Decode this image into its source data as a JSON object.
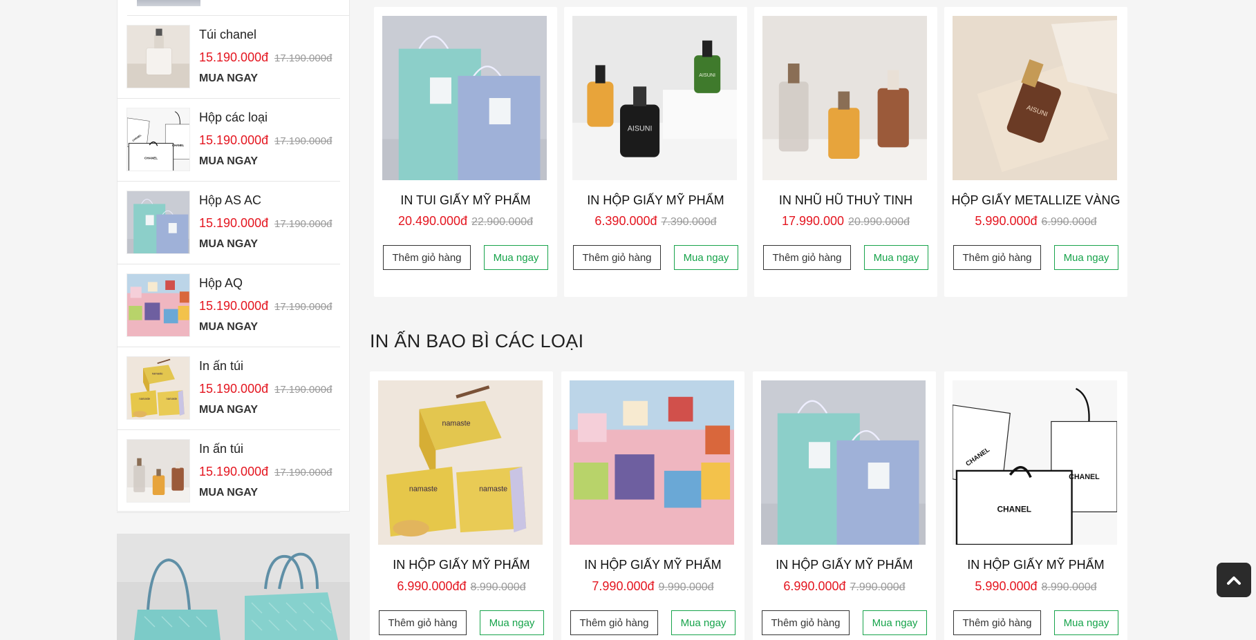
{
  "sidebar": {
    "items": [
      {
        "name": "Túi chanel",
        "price": "15.190.000đ",
        "old_price": "17.190.000đ",
        "buy_label": "MUA NGAY",
        "img": "serum"
      },
      {
        "name": "Hộp các loại",
        "price": "15.190.000đ",
        "old_price": "17.190.000đ",
        "buy_label": "MUA NGAY",
        "img": "chanel"
      },
      {
        "name": "Hộp AS AC",
        "price": "15.190.000đ",
        "old_price": "17.190.000đ",
        "buy_label": "MUA NGAY",
        "img": "bags"
      },
      {
        "name": "Hộp AQ",
        "price": "15.190.000đ",
        "old_price": "17.190.000đ",
        "buy_label": "MUA NGAY",
        "img": "cubes"
      },
      {
        "name": "In ấn túi",
        "price": "15.190.000đ",
        "old_price": "17.190.000đ",
        "buy_label": "MUA NGAY",
        "img": "boxes"
      },
      {
        "name": "In ấn túi",
        "price": "15.190.000đ",
        "old_price": "17.190.000đ",
        "buy_label": "MUA NGAY",
        "img": "bottles"
      }
    ]
  },
  "top_products": [
    {
      "title": "IN TUI GIẤY MỸ PHẨM",
      "price": "20.490.000đ",
      "old_price": "22.900.000đ",
      "img": "bags"
    },
    {
      "title": "IN HỘP GIẤY MỸ PHẨM",
      "price": "6.390.000đ",
      "old_price": "7.390.000đ",
      "img": "aisuni"
    },
    {
      "title": "IN NHŨ HŨ THUỶ TINH",
      "price": "17.990.000",
      "old_price": "20.990.000đ",
      "img": "bottles"
    },
    {
      "title": "HỘP GIẤY METALLIZE VÀNG",
      "price": "5.990.000đ",
      "old_price": "6.990.000đ",
      "img": "serum_stone"
    }
  ],
  "section": {
    "title": "IN ẤN BAO BÌ CÁC LOẠI"
  },
  "section_products": [
    {
      "title": "IN HỘP GIẤY MỸ PHẨM",
      "price": "6.990.000đđ",
      "old_price": "8.990.000đ",
      "img": "boxes"
    },
    {
      "title": "IN HỘP GIẤY MỸ PHẨM",
      "price": "7.990.000đ",
      "old_price": "9.990.000đ",
      "img": "cubes"
    },
    {
      "title": "IN HỘP GIẤY MỸ PHẨM",
      "price": "6.990.000đ",
      "old_price": "7.990.000đ",
      "img": "bags"
    },
    {
      "title": "IN HỘP GIẤY MỸ PHẨM",
      "price": "5.990.000đ",
      "old_price": "8.990.000đ",
      "img": "chanel"
    }
  ],
  "buttons": {
    "add_to_cart": "Thêm giỏ hàng",
    "buy_now": "Mua ngay"
  },
  "chanel_text": "CHANEL",
  "aisuni_text": "AISUNI",
  "namaste_text": "namaste",
  "icons": {
    "scroll_top": "chevron-up-icon"
  },
  "colors": {
    "price": "#e4151f",
    "buy_button": "#16a34a"
  }
}
